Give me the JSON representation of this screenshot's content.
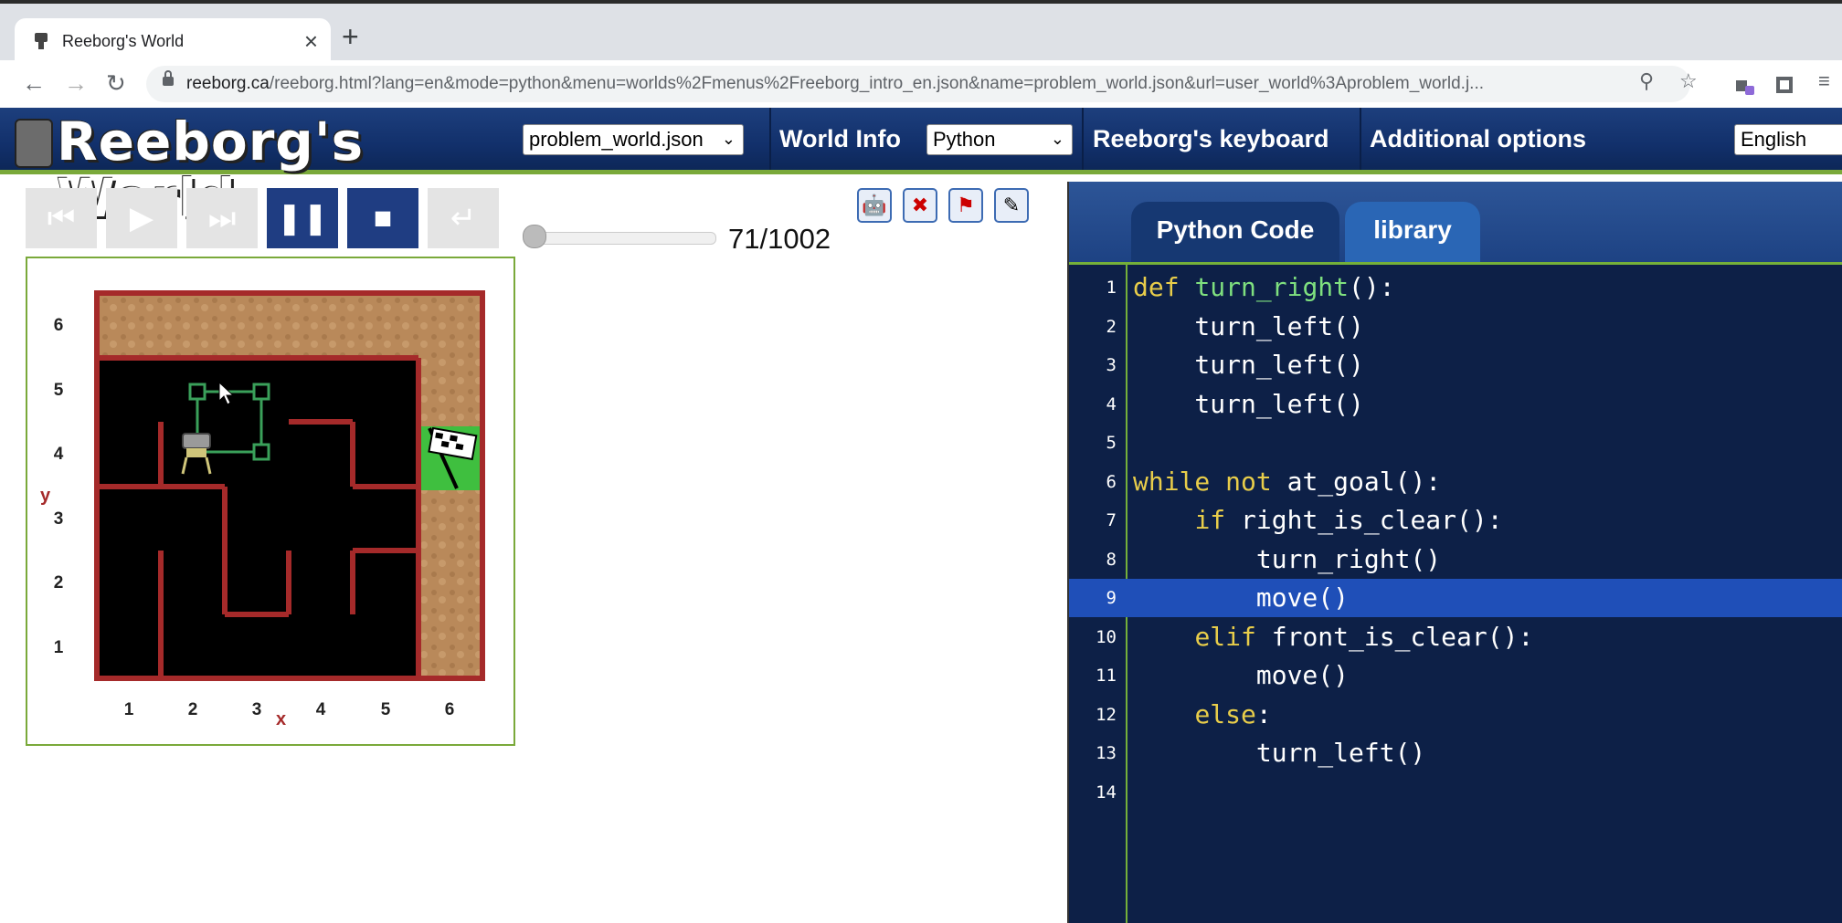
{
  "browser": {
    "tab_title": "Reeborg's World",
    "tab_close": "×",
    "new_tab": "+",
    "url_main": "reeborg.ca",
    "url_rest": "/reeborg.html?lang=en&mode=python&menu=worlds%2Fmenus%2Freeborg_intro_en.json&name=problem_world.json&url=user_world%3Aproblem_world.j..."
  },
  "header": {
    "logo_text": "Reeborg's World",
    "world_select": "problem_world.json",
    "world_info": "World Info",
    "mode_select": "Python",
    "keyboard": "Reeborg's keyboard",
    "additional_options": "Additional options",
    "language_select": "English"
  },
  "controls": {
    "step_counter": "71/1002",
    "step_current": 71,
    "step_total": 1002
  },
  "world": {
    "y_label": "y",
    "x_label": "x",
    "x_ticks": [
      "1",
      "2",
      "3",
      "4",
      "5",
      "6"
    ],
    "y_ticks": [
      "6",
      "5",
      "4",
      "3",
      "2",
      "1"
    ]
  },
  "editor": {
    "tab_code": "Python Code",
    "tab_library": "library",
    "lines": [
      {
        "n": "1",
        "text": "def turn_right():"
      },
      {
        "n": "2",
        "text": "    turn_left()"
      },
      {
        "n": "3",
        "text": "    turn_left()"
      },
      {
        "n": "4",
        "text": "    turn_left()"
      },
      {
        "n": "5",
        "text": ""
      },
      {
        "n": "6",
        "text": "while not at_goal():"
      },
      {
        "n": "7",
        "text": "    if right_is_clear():"
      },
      {
        "n": "8",
        "text": "        turn_right()"
      },
      {
        "n": "9",
        "text": "        move()"
      },
      {
        "n": "10",
        "text": "    elif front_is_clear():"
      },
      {
        "n": "11",
        "text": "        move()"
      },
      {
        "n": "12",
        "text": "    else:"
      },
      {
        "n": "13",
        "text": "        turn_left()"
      },
      {
        "n": "14",
        "text": ""
      }
    ],
    "highlighted_line": "9"
  }
}
